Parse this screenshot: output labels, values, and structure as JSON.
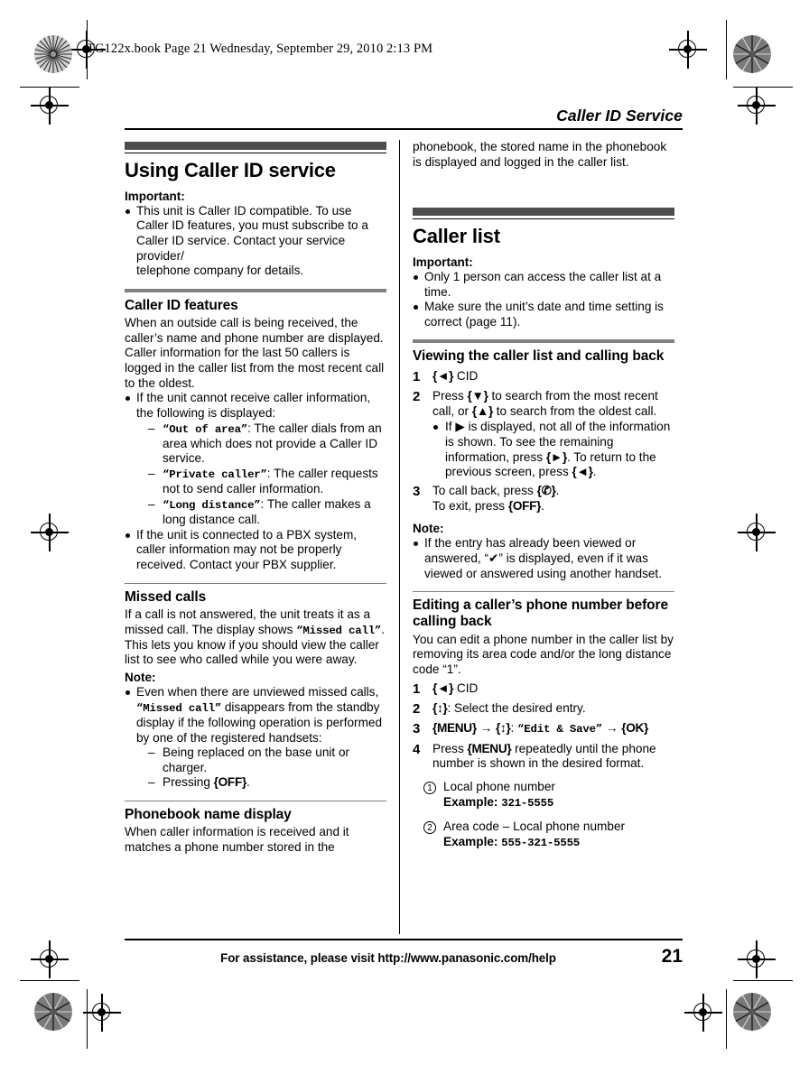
{
  "slug": "TG122x.book  Page 21  Wednesday, September 29, 2010  2:13 PM",
  "running_head": "Caller ID Service",
  "colors": {
    "chapter_bar": "#4d4d4d",
    "section_rule": "#808080",
    "text": "#000000"
  },
  "left_column": {
    "chapter_title": "Using Caller ID service",
    "important_label": "Important:",
    "important_bullets": [
      "This unit is Caller ID compatible. To use Caller ID features, you must subscribe to a Caller ID service. Contact your service provider/",
      "telephone company for details."
    ],
    "section_features": {
      "title": "Caller ID features",
      "para1": "When an outside call is being received, the caller’s name and phone number are displayed.",
      "para2": "Caller information for the last 50 callers is logged in the caller list from the most recent call to the oldest.",
      "bullet1": "If the unit cannot receive caller information, the following is displayed:",
      "dash_items": [
        {
          "code": "“Out of area”",
          "text": ": The caller dials from an area which does not provide a Caller ID service."
        },
        {
          "code": "“Private caller”",
          "text": ": The caller requests not to send caller information."
        },
        {
          "code": "“Long distance”",
          "text": ": The caller makes a long distance call."
        }
      ],
      "bullet2": "If the unit is connected to a PBX system, caller information may not be properly received. Contact your PBX supplier."
    },
    "section_missed": {
      "title": "Missed calls",
      "para_a": "If a call is not answered, the unit treats it as a missed call. The display shows ",
      "para_code": "“Missed call”",
      "para_b": ". This lets you know if you should view the caller list to see who called while you were away.",
      "note_label": "Note:",
      "note_a": "Even when there are unviewed missed calls, ",
      "note_code": "“Missed call”",
      "note_b": " disappears from the standby display if the following operation is performed by one of the registered handsets:",
      "note_dashes": [
        {
          "pre": "Being replaced on the base unit or charger.",
          "key": "",
          "post": ""
        },
        {
          "pre": "Pressing ",
          "key": "{OFF}",
          "post": "."
        }
      ]
    },
    "section_phonebook": {
      "title": "Phonebook name display",
      "para": "When caller information is received and it matches a phone number stored in the"
    }
  },
  "right_column": {
    "continuation": "phonebook, the stored name in the phonebook is displayed and logged in the caller list.",
    "chapter_title": "Caller list",
    "important_label": "Important:",
    "important_bullets": [
      "Only 1 person can access the caller list at a time.",
      "Make sure the unit’s date and time setting is correct (page 11)."
    ],
    "section_viewing": {
      "title": "Viewing the caller list and calling back",
      "steps": [
        {
          "num": "1",
          "key": "{◄}",
          "text": " CID"
        },
        {
          "num": "2",
          "pre": "Press ",
          "key1": "{▼}",
          "mid": " to search from the most recent call, or ",
          "key2": "{▲}",
          "post": " to search from the oldest call.",
          "sub_pre": "If ",
          "sub_icon": "▶",
          "sub_mid": " is displayed, not all of the information is shown. To see the remaining information, press ",
          "sub_key1": "{►}",
          "sub_mid2": ". To return to the previous screen, press ",
          "sub_key2": "{◄}",
          "sub_post": "."
        },
        {
          "num": "3",
          "line1_pre": "To call back, press ",
          "line1_key": "{✆}",
          "line1_post": ".",
          "line2_pre": "To exit, press ",
          "line2_key": "{OFF}",
          "line2_post": "."
        }
      ],
      "note_label": "Note:",
      "note": "If the entry has already been viewed or answered, “✔” is displayed, even if it was viewed or answered using another handset."
    },
    "section_editing": {
      "title": "Editing a caller’s phone number before calling back",
      "intro": "You can edit a phone number in the caller list by removing its area code and/or the long distance code “1”.",
      "steps": [
        {
          "num": "1",
          "key": "{◄}",
          "text": " CID"
        },
        {
          "num": "2",
          "key": "{↕}",
          "text": ": Select the desired entry."
        },
        {
          "num": "3",
          "key1": "{MENU}",
          "arrow1": " → ",
          "key2": "{↕}",
          "mid": ": ",
          "code": "“Edit & Save”",
          "arrow2": " → ",
          "key3": "{OK}"
        },
        {
          "num": "4",
          "pre": "Press ",
          "key": "{MENU}",
          "post": " repeatedly until the phone number is shown in the desired format."
        }
      ],
      "examples": [
        {
          "marker": "1",
          "title": "Local phone number",
          "label": "Example: ",
          "value": "321-5555"
        },
        {
          "marker": "2",
          "title": "Area code – Local phone number",
          "label": "Example: ",
          "value": "555-321-5555"
        }
      ]
    }
  },
  "footer": {
    "text": "For assistance, please visit http://www.panasonic.com/help",
    "page_number": "21"
  }
}
